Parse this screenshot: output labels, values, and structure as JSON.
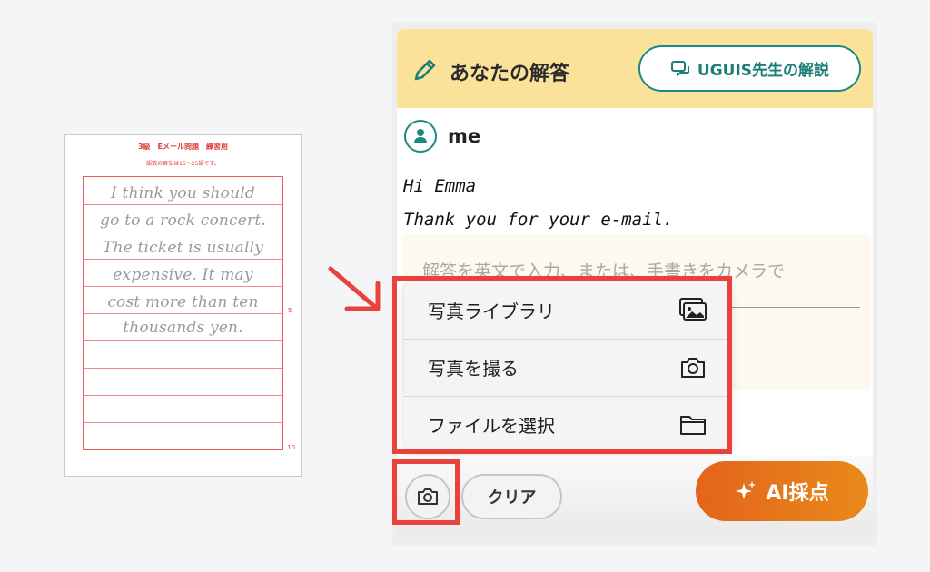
{
  "sheet": {
    "title": "3級　Eメール問題　練習用",
    "note": "語数の目安は15〜25語です。",
    "handwriting": [
      "I think you should",
      "go to a rock concert.",
      "The ticket is usually",
      "expensive. It may",
      "cost more than ten",
      "thousands yen."
    ],
    "line_number_5": "5",
    "line_number_10": "10"
  },
  "header": {
    "title": "あなたの解答",
    "explain_button": "UGUIS先生の解説"
  },
  "user": {
    "name": "me"
  },
  "answer": {
    "line1": "Hi Emma",
    "line2": "Thank you for your e-mail."
  },
  "input": {
    "placeholder": "解答を英文で入力、または、手書きをカメラで"
  },
  "popup_menu": {
    "items": [
      {
        "label": "写真ライブラリ",
        "icon": "photo-library-icon"
      },
      {
        "label": "写真を撮る",
        "icon": "camera-icon"
      },
      {
        "label": "ファイルを選択",
        "icon": "folder-icon"
      }
    ]
  },
  "toolbar": {
    "clear_label": "クリア",
    "ai_label": "AI採点"
  },
  "colors": {
    "header_bg": "#fbe29a",
    "teal": "#1b8a80",
    "highlight_red": "#e8413e",
    "ai_orange": "#e3641b"
  }
}
